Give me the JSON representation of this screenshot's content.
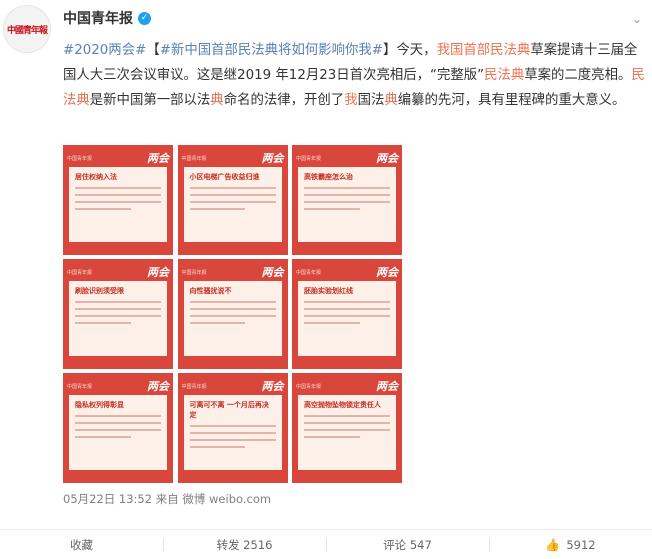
{
  "author": {
    "avatar_text": "中國青年報",
    "name": "中国青年报",
    "verified_mark": "✓"
  },
  "post": {
    "p1": "#2020两会#",
    "p2": "【",
    "p3": "#新中国首部民法典将如何影响你我#",
    "p4": "】今天，",
    "p5": "我国首部民法典",
    "p6": "草案提请十三届全国人大三次会议审议。这是继2019 年12月23日首次亮相后，“完整版”",
    "p7": "民法典",
    "p8": "草案的二度亮相。",
    "p9": "民法典",
    "p10": "是新中国第一部以法",
    "p11": "典",
    "p12": "命名的法律，开创了",
    "p13": "我",
    "p14": "国法",
    "p15": "典",
    "p16": "编纂的先河，具有里程碑的重大意义。"
  },
  "cards": [
    {
      "brand": "中国青年报",
      "badge": "两会",
      "title": "居住权纳入法"
    },
    {
      "brand": "中国青年报",
      "badge": "两会",
      "title": "小区电梯广告收益归谁"
    },
    {
      "brand": "中国青年报",
      "badge": "两会",
      "title": "高铁霸座怎么治"
    },
    {
      "brand": "中国青年报",
      "badge": "两会",
      "title": "刷脸识别须受限"
    },
    {
      "brand": "中国青年报",
      "badge": "两会",
      "title": "向性骚扰说不"
    },
    {
      "brand": "中国青年报",
      "badge": "两会",
      "title": "胚胎实验划红线"
    },
    {
      "brand": "中国青年报",
      "badge": "两会",
      "title": "隐私权列得彰显"
    },
    {
      "brand": "中国青年报",
      "badge": "两会",
      "title": "可离可不离 一个月后再决定"
    },
    {
      "brand": "中国青年报",
      "badge": "两会",
      "title": "高空抛物坠物锁定责任人"
    }
  ],
  "meta": "05月22日 13:52 来自 微博 weibo.com",
  "actions": {
    "favorite": "收藏",
    "repost": "转发 2516",
    "comment": "评论 547",
    "like_icon": "👍",
    "like_count": "5912"
  },
  "colors": {
    "card_red": "#d8463c",
    "highlight": "#eb7350",
    "link": "#5b80b6"
  }
}
